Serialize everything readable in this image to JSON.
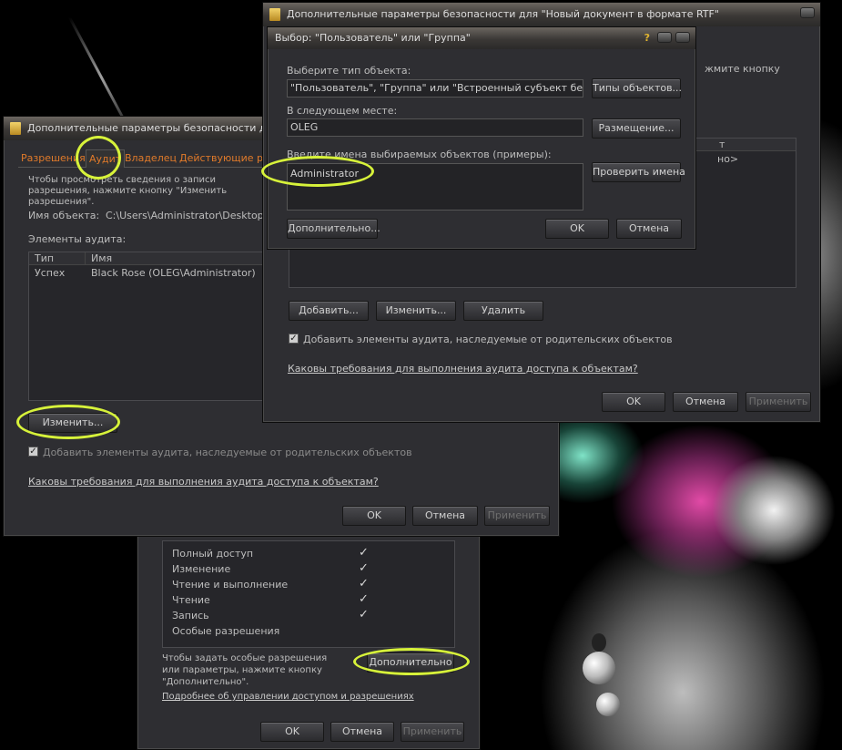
{
  "window_perm": {
    "permissions": [
      {
        "name": "Полный доступ"
      },
      {
        "name": "Изменение"
      },
      {
        "name": "Чтение и выполнение"
      },
      {
        "name": "Чтение"
      },
      {
        "name": "Запись"
      },
      {
        "name": "Особые разрешения"
      }
    ],
    "special_hint": "Чтобы задать особые разрешения или параметры, нажмите кнопку \"Дополнительно\".",
    "advanced_button": "Дополнительно",
    "help_link": "Подробнее об управлении доступом и разрешениях",
    "ok": "OK",
    "cancel": "Отмена",
    "apply": "Применить"
  },
  "window_audit": {
    "title": "Дополнительные параметры безопасности для",
    "tabs": [
      "Разрешения",
      "Аудит",
      "Владелец",
      "Действующие раз"
    ],
    "intro": "Чтобы просмотреть сведения о записи разрешения, нажмите кнопку \"Изменить разрешения\".",
    "object_name_label": "Имя объекта:",
    "object_name_value": "C:\\Users\\Administrator\\Desktop\\Нов",
    "entries_label": "Элементы аудита:",
    "columns": [
      "Тип",
      "Имя"
    ],
    "rows": [
      {
        "type": "Успех",
        "name": "Black Rose (OLEG\\Administrator)"
      }
    ],
    "edit_button": "Изменить...",
    "inherit_checkbox": "Добавить элементы аудита, наследуемые от родительских объектов",
    "requirements_link": "Каковы требования для выполнения аудита доступа к объектам?",
    "ok": "OK",
    "cancel": "Отмена",
    "apply": "Применить"
  },
  "window_main": {
    "title": "Дополнительные параметры безопасности для \"Новый документ в формате RTF\"",
    "hint_right": "жмите кнопку",
    "col_right": "т",
    "row_right": "но>",
    "add_button": "Добавить...",
    "edit_button": "Изменить...",
    "delete_button": "Удалить",
    "inherit_checkbox": "Добавить элементы аудита, наследуемые от родительских объектов",
    "requirements_link": "Каковы требования для выполнения аудита доступа к объектам?",
    "ok": "OK",
    "cancel": "Отмена",
    "apply": "Применить"
  },
  "dialog_select": {
    "title": "Выбор: \"Пользователь\" или \"Группа\"",
    "help_glyph": "?",
    "object_type_label": "Выберите тип объекта:",
    "object_type_value": "\"Пользователь\", \"Группа\" или \"Встроенный субъект безопаснос",
    "object_types_button": "Типы объектов...",
    "location_label": "В следующем месте:",
    "location_value": "OLEG",
    "location_button": "Размещение...",
    "names_label": "Введите имена выбираемых объектов (примеры):",
    "names_value": "Administrator",
    "check_names_button": "Проверить имена",
    "advanced_button": "Дополнительно...",
    "ok": "OK",
    "cancel": "Отмена"
  },
  "colors": {
    "tab_text": "#e07a2a",
    "highlight": "#d7f23a"
  }
}
